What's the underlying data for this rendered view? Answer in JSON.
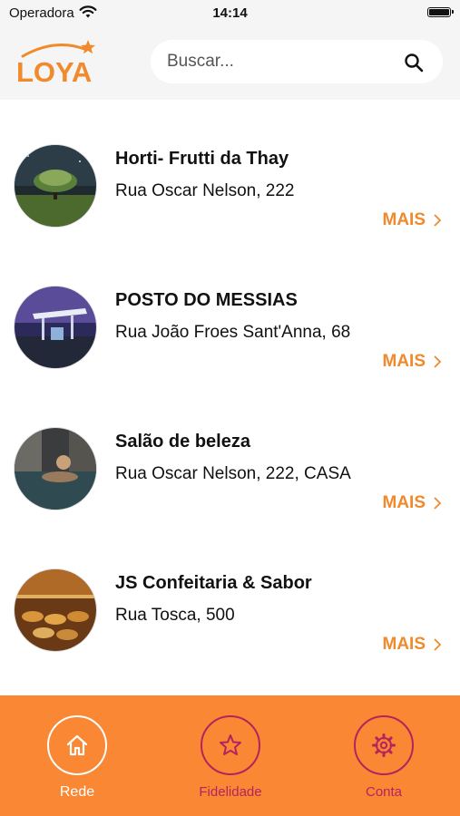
{
  "status_bar": {
    "carrier": "Operadora",
    "time": "14:14"
  },
  "header": {
    "logo_text": "LOYA",
    "search": {
      "placeholder": "Buscar...",
      "value": ""
    }
  },
  "colors": {
    "accent": "#f08a2c",
    "tabbar": "#f98733",
    "inactive_tab": "#b3245f",
    "active_tab": "#ffffff"
  },
  "stores": [
    {
      "name": "Horti- Frutti da Thay",
      "address": "Rua Oscar Nelson, 222",
      "more": "MAIS",
      "image": "tree-night-photo"
    },
    {
      "name": "POSTO DO MESSIAS",
      "address": "Rua João Froes Sant'Anna, 68",
      "more": "MAIS",
      "image": "gas-station-photo"
    },
    {
      "name": "Salão de beleza",
      "address": "Rua Oscar Nelson, 222, CASA",
      "more": "MAIS",
      "image": "spa-pool-photo"
    },
    {
      "name": "JS Confeitaria & Sabor",
      "address": "Rua Tosca, 500",
      "more": "MAIS",
      "image": "bakery-photo"
    }
  ],
  "tabs": [
    {
      "label": "Rede",
      "icon": "home-icon",
      "active": true
    },
    {
      "label": "Fidelidade",
      "icon": "star-icon",
      "active": false
    },
    {
      "label": "Conta",
      "icon": "gear-icon",
      "active": false
    }
  ]
}
